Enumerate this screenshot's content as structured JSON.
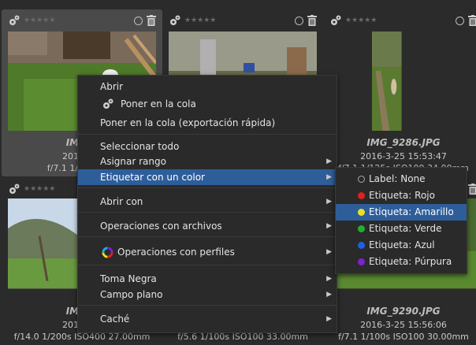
{
  "thumbnails": [
    {
      "name": "IMG_9",
      "date": "2016-3-2",
      "exif": "f/7.1 1/100s ISO"
    },
    {
      "name": "",
      "date": "",
      "exif": ""
    },
    {
      "name": "IMG_9286.JPG",
      "date": "2016-3-25 15:53:47",
      "exif": "f/7.1 1/125s ISO100 34.00mm"
    },
    {
      "name": "IMG_9",
      "date": "2016-3-2",
      "exif": "f/14.0 1/200s ISO400 27.00mm"
    },
    {
      "name": "",
      "date": "",
      "exif": "f/5.6 1/100s ISO100 33.00mm"
    },
    {
      "name": "IMG_9290.JPG",
      "date": "2016-3-25 15:56:06",
      "exif": "f/7.1 1/100s ISO100 30.00mm"
    }
  ],
  "menu": {
    "open": "Abrir",
    "queue": "Poner en la cola",
    "queue_fast": "Poner en la cola (exportación rápida)",
    "select_all": "Seleccionar todo",
    "assign_range": "Asignar rango",
    "color_label": "Etiquetar con un color",
    "open_with": "Abrir con",
    "file_ops": "Operaciones con archivos",
    "profile_ops": "Operaciones con perfiles",
    "dark_frame": "Toma Negra",
    "flat_field": "Campo plano",
    "cache": "Caché",
    "arrow": "▶"
  },
  "submenu": {
    "none": "Label: None",
    "red": "Etiqueta: Rojo",
    "yellow": "Etiqueta: Amarillo",
    "green": "Etiqueta: Verde",
    "blue": "Etiqueta: Azul",
    "purple": "Etiqueta: Púrpura"
  },
  "stars": "★★★★★",
  "colors": {
    "highlight": "#2e5e9a",
    "red": "#e02020",
    "yellow": "#e8e020",
    "green": "#20b030",
    "blue": "#2060e0",
    "purple": "#8020d0"
  }
}
